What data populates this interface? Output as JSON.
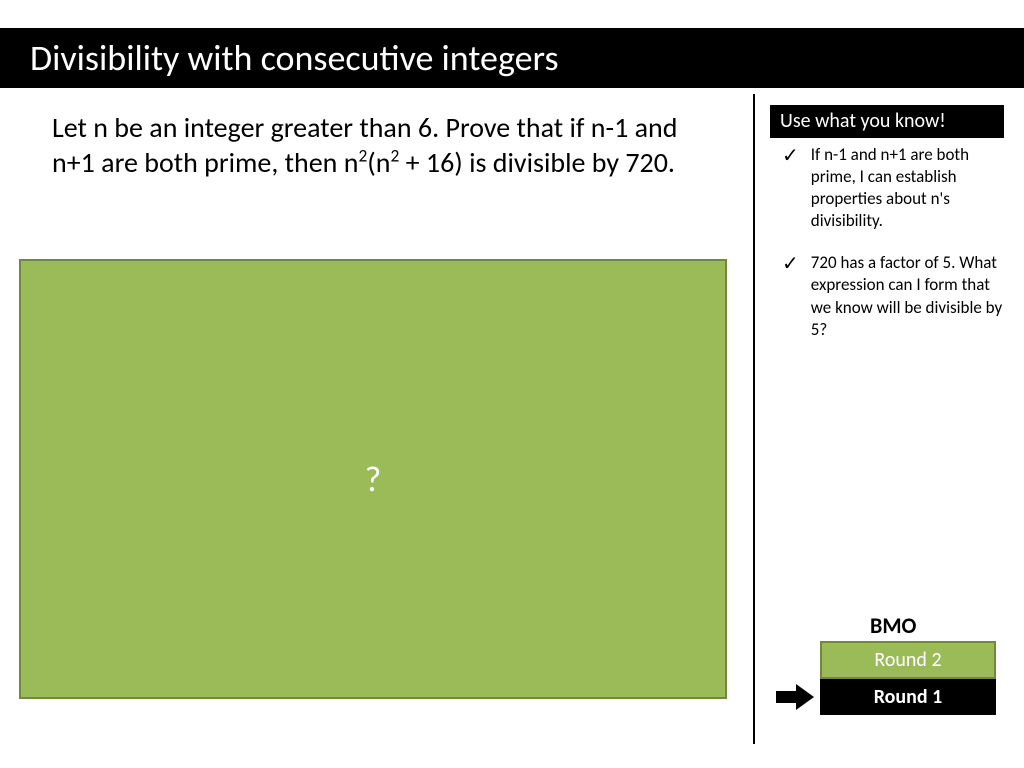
{
  "title": "Divisibility with consecutive integers",
  "problem": {
    "part1": "Let n be an integer greater than 6. Prove that if n-1 and n+1 are both prime, then n",
    "sup1": "2",
    "part2": "(n",
    "sup2": "2",
    "part3": " + 16) is divisible by 720."
  },
  "answer_placeholder": "?",
  "hints": {
    "header": "Use what you know!",
    "items": [
      "If n-1 and n+1 are both prime, I can establish properties about n's divisibility.",
      "720 has a factor of 5. What expression can I form that we know will be divisible by 5?"
    ]
  },
  "bmo": {
    "label": "BMO",
    "round2": "Round 2",
    "round1": "Round 1"
  }
}
